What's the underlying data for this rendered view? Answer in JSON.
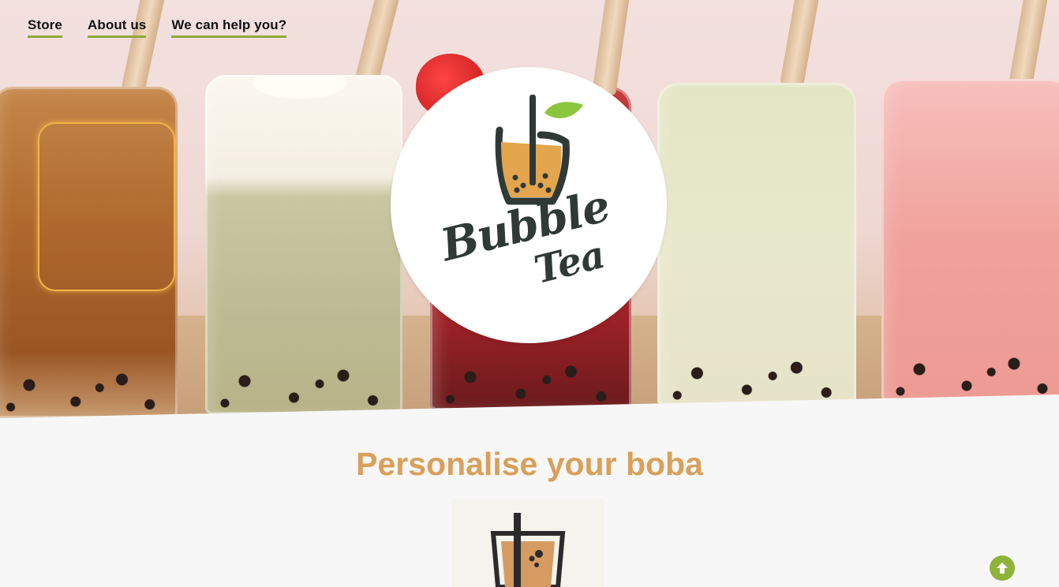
{
  "nav": {
    "items": [
      {
        "label": "Store"
      },
      {
        "label": "About us"
      },
      {
        "label": "We can help you?"
      }
    ]
  },
  "logo": {
    "line1": "Bubble",
    "line2": "Tea"
  },
  "section": {
    "title": "Personalise your boba"
  },
  "colors": {
    "accent_green": "#8faa3a",
    "title_orange": "#d9a05b",
    "logo_dark": "#2f3a37",
    "leaf_green": "#8cc63f",
    "tea_orange": "#e3a54d"
  },
  "icons": {
    "scroll_top": "arrow-up-icon"
  }
}
